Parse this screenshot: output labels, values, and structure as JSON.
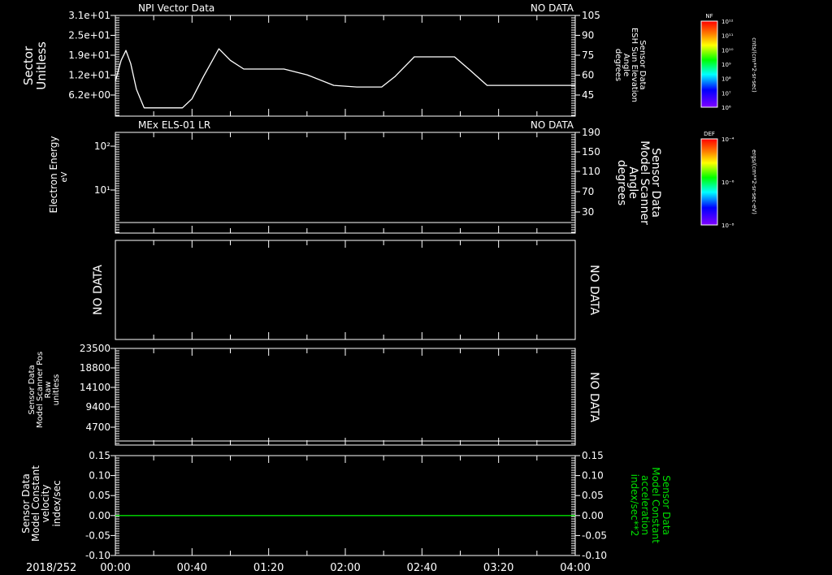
{
  "date_label": "2018/252",
  "colors": {
    "foreground": "#ffffff",
    "background": "#000000",
    "green": "#00e000"
  },
  "colorbars": [
    {
      "title": "NF",
      "labels": [
        "10¹²",
        "10¹¹",
        "10¹⁰",
        "10⁹",
        "10⁸",
        "10⁷",
        "10⁶"
      ],
      "units": "cnts/(cm**2-sr-sec)"
    },
    {
      "title": "DEF",
      "labels": [
        "10⁻⁴",
        "10⁻⁶",
        "10⁻⁸"
      ],
      "units": "ergs/(cm**2-sr-sec-eV)"
    }
  ],
  "chart_data": [
    {
      "type": "line",
      "title": "NPI Vector Data",
      "status": "NO DATA",
      "ylabel": [
        "Sector",
        "Unitless"
      ],
      "yticks": [
        "3.1e+01",
        "2.5e+01",
        "1.9e+01",
        "1.2e+01",
        "6.2e+00"
      ],
      "ylim": [
        0,
        31
      ],
      "y2label": [
        "Sensor Data",
        "ESH Sun Elevation",
        "Angle",
        "degrees"
      ],
      "y2ticks": [
        "105",
        "90",
        "75",
        "60",
        "45"
      ],
      "y2lim": [
        30,
        105
      ],
      "x": [
        0,
        3,
        5.5,
        8,
        11,
        15,
        25,
        35,
        40,
        46,
        54,
        60,
        67,
        80,
        88,
        100,
        114,
        126,
        139,
        146,
        156,
        166,
        177,
        185,
        194,
        220,
        240
      ],
      "y": [
        10.5,
        17,
        20.1,
        16,
        8,
        2.2,
        2.2,
        2.2,
        5,
        12,
        20.6,
        17,
        14.3,
        14.3,
        14.3,
        12.5,
        9.2,
        8.7,
        8.7,
        12,
        18.1,
        18.1,
        18.1,
        14,
        9.2,
        9.2,
        9.2
      ]
    },
    {
      "type": "line",
      "title": "MEx ELS-01 LR",
      "status": "NO DATA",
      "ylabel": [
        "Electron Energy",
        "eV"
      ],
      "yticks": [
        "10²",
        "10¹"
      ],
      "y2label": [
        "Sensor Data",
        "Model Scanner",
        "Angle",
        "degrees"
      ],
      "y2ticks": [
        "190",
        "150",
        "110",
        "70",
        "30"
      ]
    },
    {
      "type": "line",
      "status_left": "NO DATA",
      "status_right": "NO DATA"
    },
    {
      "type": "line",
      "ylabel": [
        "Sensor Data",
        "Model Scanner Pos",
        "Raw",
        "unitless"
      ],
      "yticks": [
        "23500",
        "18800",
        "14100",
        "9400",
        "4700"
      ],
      "status_right": "NO DATA"
    },
    {
      "type": "line",
      "ylabel": [
        "Sensor Data",
        "Model Constant",
        "velocity",
        "index/sec"
      ],
      "yticks": [
        "0.15",
        "0.10",
        "0.05",
        "0.00",
        "-0.05",
        "-0.10"
      ],
      "ylim": [
        -0.1,
        0.15
      ],
      "y2label": [
        "Sensor Data",
        "Model Constant",
        "acceleration",
        "index/sec**2"
      ],
      "y2ticks": [
        "0.15",
        "0.10",
        "0.05",
        "0.00",
        "-0.05",
        "-0.10"
      ],
      "series": [
        {
          "x": [
            0,
            240
          ],
          "y": [
            0,
            0
          ]
        }
      ]
    }
  ],
  "xaxis": {
    "ticks": [
      "00:00",
      "00:40",
      "01:20",
      "02:00",
      "02:40",
      "03:20",
      "04:00"
    ],
    "range_minutes": [
      0,
      240
    ]
  }
}
